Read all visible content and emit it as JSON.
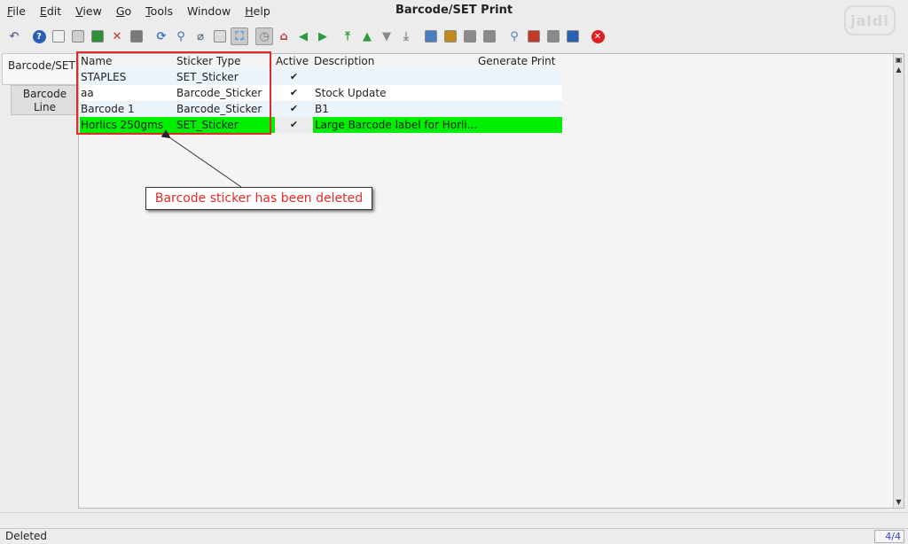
{
  "window": {
    "title": "Barcode/SET Print",
    "logo_text": "jaldi"
  },
  "menu": [
    {
      "label": "File",
      "mnemonic": "F",
      "rest": "ile"
    },
    {
      "label": "Edit",
      "mnemonic": "E",
      "rest": "dit"
    },
    {
      "label": "View",
      "mnemonic": "V",
      "rest": "iew"
    },
    {
      "label": "Go",
      "mnemonic": "G",
      "rest": "o"
    },
    {
      "label": "Tools",
      "mnemonic": "T",
      "rest": "ools"
    },
    {
      "label": "Window",
      "mnemonic": "",
      "rest": "Window"
    },
    {
      "label": "Help",
      "mnemonic": "H",
      "rest": "elp"
    }
  ],
  "toolbar": {
    "icons": [
      {
        "name": "undo-icon",
        "color": "#5a6e8c",
        "glyph": "↶"
      },
      {
        "name": "help-icon",
        "color": "#2b5fb3",
        "glyph": "?"
      },
      {
        "name": "new-icon",
        "color": "#f0f0f0",
        "glyph": ""
      },
      {
        "name": "copy-icon",
        "color": "#cfcfcf",
        "glyph": ""
      },
      {
        "name": "save-icon",
        "color": "#2f8f3a",
        "glyph": ""
      },
      {
        "name": "delete-icon",
        "color": "#d32f2f",
        "glyph": "✕"
      },
      {
        "name": "delete-selection-icon",
        "color": "#7a7a7a",
        "glyph": ""
      },
      {
        "name": "refresh-icon",
        "color": "#3b77c4",
        "glyph": "⟳"
      },
      {
        "name": "find-icon",
        "color": "#3a6fb0",
        "glyph": "⚲"
      },
      {
        "name": "attachment-icon",
        "color": "#5a6e8c",
        "glyph": "⌀"
      },
      {
        "name": "chat-icon",
        "color": "#dcdcdc",
        "glyph": ""
      },
      {
        "name": "grid-toggle-icon",
        "color": "#4f8fd6",
        "glyph": "⛶"
      },
      {
        "name": "history-icon",
        "color": "#7d7d7d",
        "glyph": "◷"
      },
      {
        "name": "home-icon",
        "color": "#c0392b",
        "glyph": "⌂"
      },
      {
        "name": "parent-record-icon",
        "color": "#2d9a3c",
        "glyph": "◀"
      },
      {
        "name": "detail-record-icon",
        "color": "#2d9a3c",
        "glyph": "▶"
      },
      {
        "name": "first-record-icon",
        "color": "#2d9a3c",
        "glyph": "⤒"
      },
      {
        "name": "previous-record-icon",
        "color": "#2d9a3c",
        "glyph": "▲"
      },
      {
        "name": "next-record-icon",
        "color": "#8a8a8a",
        "glyph": "▼"
      },
      {
        "name": "last-record-icon",
        "color": "#8a8a8a",
        "glyph": "⤓"
      },
      {
        "name": "report-icon",
        "color": "#4a7fbf",
        "glyph": ""
      },
      {
        "name": "archive-icon",
        "color": "#c08a1e",
        "glyph": ""
      },
      {
        "name": "print-preview-icon",
        "color": "#8a8a8a",
        "glyph": ""
      },
      {
        "name": "print-icon",
        "color": "#8a8a8a",
        "glyph": ""
      },
      {
        "name": "zoom-across-icon",
        "color": "#4a7fbf",
        "glyph": "⚲"
      },
      {
        "name": "workflow-icon",
        "color": "#c0392b",
        "glyph": ""
      },
      {
        "name": "process-icon",
        "color": "#8a8a8a",
        "glyph": ""
      },
      {
        "name": "product-info-icon",
        "color": "#2b5fb3",
        "glyph": ""
      },
      {
        "name": "exit-icon",
        "color": "#e02020",
        "glyph": "✕"
      }
    ]
  },
  "tabs": {
    "main": "Barcode/SET",
    "sub": [
      "Barcode",
      "Line"
    ]
  },
  "table": {
    "headers": {
      "name": "Name",
      "sticker_type": "Sticker Type",
      "active": "Active",
      "description": "Description",
      "generate_print": "Generate Print"
    },
    "rows": [
      {
        "name": "STAPLES",
        "sticker_type": "SET_Sticker",
        "active": "✔",
        "description": "",
        "generate_print": "",
        "style": "alt"
      },
      {
        "name": "aa",
        "sticker_type": "Barcode_Sticker",
        "active": "✔",
        "description": "Stock Update",
        "generate_print": "",
        "style": "white"
      },
      {
        "name": "Barcode 1",
        "sticker_type": "Barcode_Sticker",
        "active": "✔",
        "description": "B1",
        "generate_print": "",
        "style": "alt"
      },
      {
        "name": "Horlics 250gms",
        "sticker_type": "SET_Sticker",
        "active": "✔",
        "description": "Large Barcode label for Horli...",
        "generate_print": "",
        "style": "sel"
      }
    ]
  },
  "annotation": {
    "callout_text": "Barcode sticker has been deleted",
    "box_color": "#e12b2b"
  },
  "status": {
    "text": "Deleted",
    "record_count": "4/4"
  },
  "colors": {
    "selected_row": "#00ee00",
    "alt_row": "#ecf4fb",
    "record_count_text": "#3a44c8"
  }
}
